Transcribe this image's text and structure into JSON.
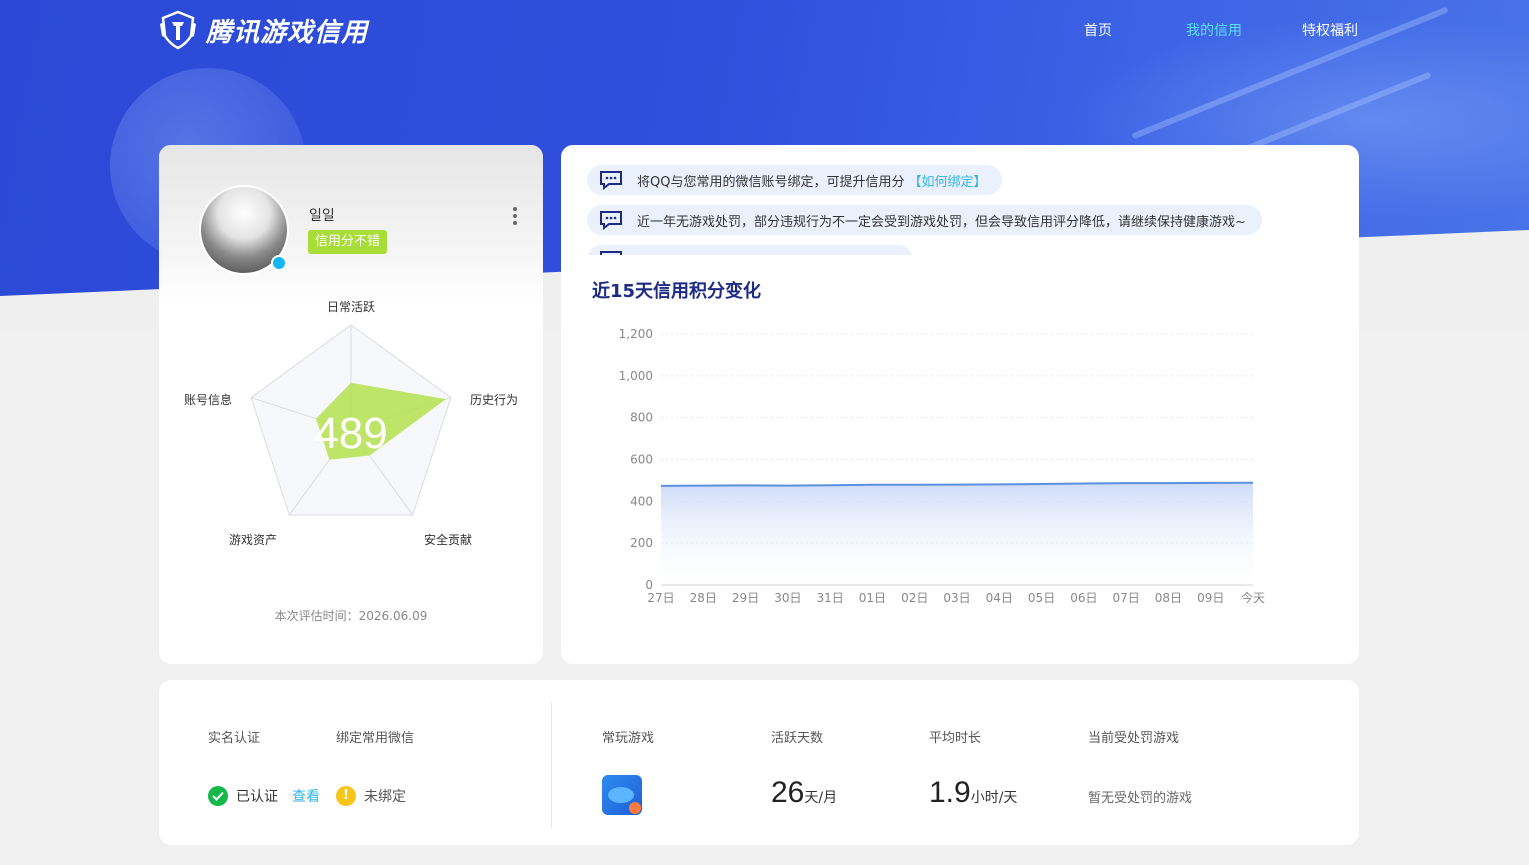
{
  "header": {
    "brand": "腾讯游戏信用",
    "nav": [
      {
        "label": "首页",
        "active": false
      },
      {
        "label": "我的信用",
        "active": true
      },
      {
        "label": "特权福利",
        "active": false
      }
    ]
  },
  "profile": {
    "username": "일일",
    "credit_tag": "信用分不错",
    "score": "489",
    "radar_labels": [
      "日常活跃",
      "历史行为",
      "安全贡献",
      "游戏资产",
      "账号信息"
    ],
    "radar_values": [
      0.45,
      0.95,
      0.3,
      0.35,
      0.35
    ],
    "eval_time": "本次评估时间：2026.06.09"
  },
  "notices": [
    {
      "text": "将QQ与您常用的微信账号绑定，可提升信用分",
      "link": "【如何绑定】"
    },
    {
      "text": "近一年无游戏处罚，部分违规行为不一定会受到游戏处罚，但会导致信用评分降低，请继续保持健康游戏~",
      "link": ""
    },
    {
      "text": "",
      "link": ""
    }
  ],
  "chart_data": {
    "type": "area",
    "title": "近15天信用积分变化",
    "categories": [
      "27日",
      "28日",
      "29日",
      "30日",
      "31日",
      "01日",
      "02日",
      "03日",
      "04日",
      "05日",
      "06日",
      "07日",
      "08日",
      "09日",
      "今天"
    ],
    "values": [
      474,
      475,
      476,
      475,
      477,
      479,
      479,
      480,
      481,
      483,
      485,
      487,
      487,
      488,
      489
    ],
    "ylim": [
      0,
      1200
    ],
    "yticks": [
      "1,200",
      "1,000",
      "800",
      "600",
      "400",
      "200",
      "0"
    ],
    "color": "#5b8fe0"
  },
  "bottom": {
    "realname_label": "实名认证",
    "wechat_label": "绑定常用微信",
    "realname_status": "已认证",
    "view_link": "查看",
    "wechat_status": "未绑定",
    "frequent_games_label": "常玩游戏",
    "active_days_label": "活跃天数",
    "active_days_value": "26",
    "active_days_unit": "天/月",
    "avg_time_label": "平均时长",
    "avg_time_value": "1.9",
    "avg_time_unit": "小时/天",
    "punish_label": "当前受处罚游戏",
    "punish_value": "暂无受处罚的游戏"
  }
}
